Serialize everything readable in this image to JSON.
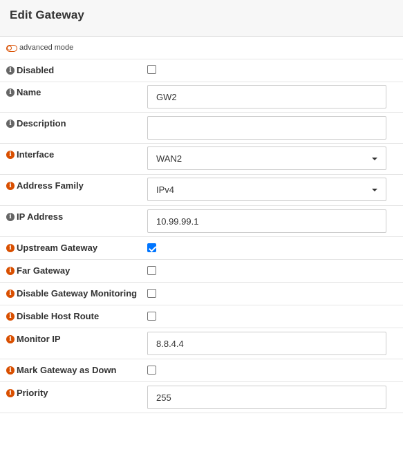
{
  "header": {
    "title": "Edit Gateway"
  },
  "advanced_mode": {
    "label": "advanced mode"
  },
  "fields": {
    "disabled": {
      "label": "Disabled",
      "checked": false
    },
    "name": {
      "label": "Name",
      "value": "GW2"
    },
    "description": {
      "label": "Description",
      "value": ""
    },
    "interface": {
      "label": "Interface",
      "selected": "WAN2"
    },
    "address_family": {
      "label": "Address Family",
      "selected": "IPv4"
    },
    "ip_address": {
      "label": "IP Address",
      "value": "10.99.99.1"
    },
    "upstream_gateway": {
      "label": "Upstream Gateway",
      "checked": true
    },
    "far_gateway": {
      "label": "Far Gateway",
      "checked": false
    },
    "disable_monitoring": {
      "label": "Disable Gateway Monitoring",
      "checked": false
    },
    "disable_host_route": {
      "label": "Disable Host Route",
      "checked": false
    },
    "monitor_ip": {
      "label": "Monitor IP",
      "value": "8.8.4.4"
    },
    "mark_down": {
      "label": "Mark Gateway as Down",
      "checked": false
    },
    "priority": {
      "label": "Priority",
      "value": "255"
    }
  },
  "colors": {
    "accent": "#d94f00",
    "info_gray": "#666666",
    "checkbox_checked": "#0075ff"
  },
  "icons": {
    "info": "info-circle-icon"
  }
}
